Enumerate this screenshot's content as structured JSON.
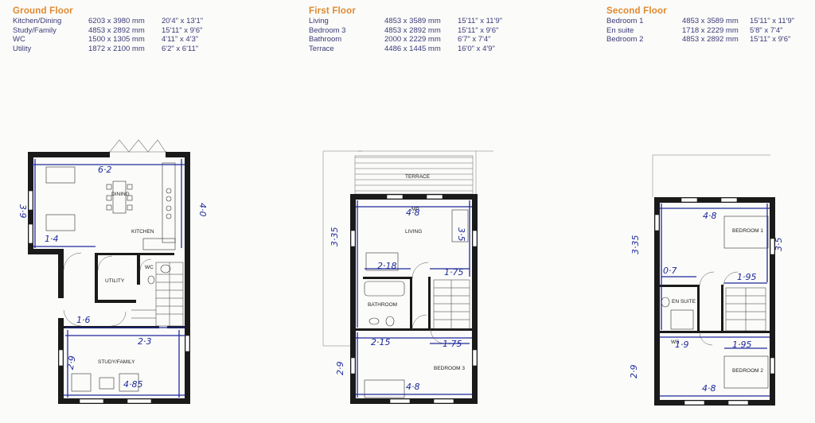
{
  "floors": [
    {
      "title": "Ground Floor",
      "rooms": [
        {
          "name": "Kitchen/Dining",
          "metric": "6203 x 3980 mm",
          "imperial": "20'4\" x 13'1\""
        },
        {
          "name": "Study/Family",
          "metric": "4853 x 2892 mm",
          "imperial": "15'11\" x 9'6\""
        },
        {
          "name": "WC",
          "metric": "1500 x 1305 mm",
          "imperial": "4'11\" x 4'3\""
        },
        {
          "name": "Utility",
          "metric": "1872 x 2100 mm",
          "imperial": "6'2\" x 6'11\""
        }
      ]
    },
    {
      "title": "First Floor",
      "rooms": [
        {
          "name": "Living",
          "metric": "4853 x 3589 mm",
          "imperial": "15'11\" x 11'9\""
        },
        {
          "name": "Bedroom 3",
          "metric": "4853 x 2892 mm",
          "imperial": "15'11\" x 9'6\""
        },
        {
          "name": "Bathroom",
          "metric": "2000 x 2229 mm",
          "imperial": "6'7\" x 7'4\""
        },
        {
          "name": "Terrace",
          "metric": "4486 x 1445 mm",
          "imperial": "16'0\" x 4'9\""
        }
      ]
    },
    {
      "title": "Second Floor",
      "rooms": [
        {
          "name": "Bedroom 1",
          "metric": "4853 x 3589 mm",
          "imperial": "15'11\" x 11'9\""
        },
        {
          "name": "En suite",
          "metric": "1718 x 2229 mm",
          "imperial": "5'8\" x 7'4\""
        },
        {
          "name": "Bedroom 2",
          "metric": "4853 x 2892 mm",
          "imperial": "15'11\" x 9'6\""
        }
      ]
    }
  ],
  "plan_labels": {
    "dining": "DINING",
    "kitchen": "KITCHEN",
    "wc": "WC",
    "utility": "UTILITY",
    "study_family": "STUDY/FAMILY",
    "terrace": "TERRACE",
    "living": "LIVING",
    "bathroom": "BATHROOM",
    "bedroom3": "BEDROOM 3",
    "mp": "MP",
    "bedroom1": "BEDROOM 1",
    "ensuite": "EN SUITE",
    "ws": "WS",
    "bedroom2": "BEDROOM 2"
  },
  "handwritten": {
    "g_6_2": "6·2",
    "g_3_9": "3·9",
    "g_4_0": "4·0",
    "g_1_4": "1·4",
    "g_1_6": "1·6",
    "g_2_3": "2·3",
    "g_2_9": "2·9",
    "g_4_85": "4·85",
    "f_4_8_top": "4·8",
    "f_3_35": "3·35",
    "f_3_5": "3·5",
    "f_2_18": "2·18",
    "f_1_75a": "1·75",
    "f_2_15": "2·15",
    "f_1_75b": "1·75",
    "f_2_9": "2·9",
    "f_4_8_bot": "4·8",
    "s_4_8_top": "4·8",
    "s_3_35": "3·35",
    "s_3_5": "3·5",
    "s_0_7": "0·7",
    "s_1_95a": "1·95",
    "s_1_9": "1·9",
    "s_1_95b": "1·95",
    "s_2_9": "2·9",
    "s_4_8_bot": "4·8"
  },
  "colors": {
    "accent_title": "#e0892f",
    "table_text": "#3b3b7a",
    "wall": "#1a1a1a",
    "pen": "#1f2a9c"
  }
}
